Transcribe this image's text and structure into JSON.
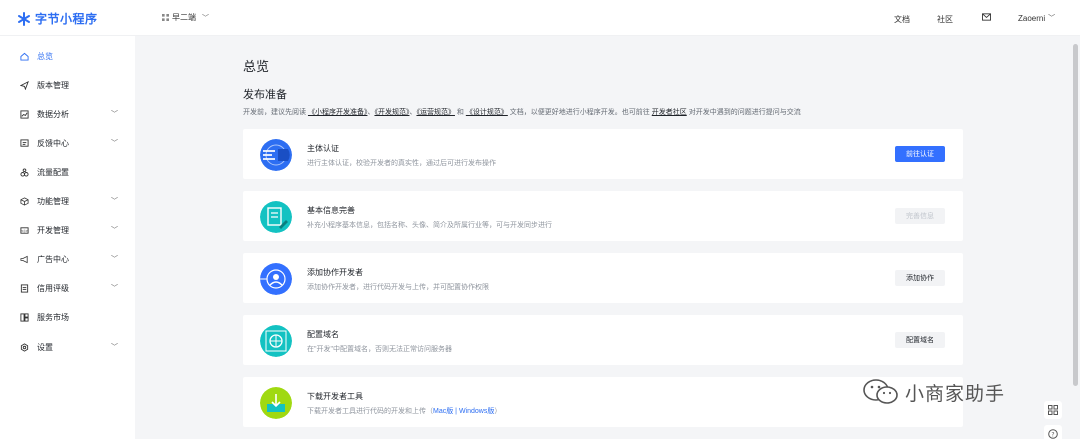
{
  "brand": {
    "name": "字节小程序",
    "color": "#2d6ef2"
  },
  "app_switch": {
    "label": "早二端"
  },
  "header": {
    "docs": "文档",
    "community": "社区",
    "user": "Zaoerni"
  },
  "sidebar": {
    "items": [
      {
        "label": "总览",
        "icon": "home-icon",
        "active": true,
        "expandable": false
      },
      {
        "label": "版本管理",
        "icon": "send-icon",
        "active": false,
        "expandable": false
      },
      {
        "label": "数据分析",
        "icon": "chart-icon",
        "active": false,
        "expandable": true
      },
      {
        "label": "反馈中心",
        "icon": "feedback-icon",
        "active": false,
        "expandable": true
      },
      {
        "label": "流量配置",
        "icon": "flow-icon",
        "active": false,
        "expandable": false
      },
      {
        "label": "功能管理",
        "icon": "cube-icon",
        "active": false,
        "expandable": true
      },
      {
        "label": "开发管理",
        "icon": "dev-icon",
        "active": false,
        "expandable": true
      },
      {
        "label": "广告中心",
        "icon": "megaphone-icon",
        "active": false,
        "expandable": true
      },
      {
        "label": "信用评级",
        "icon": "credit-icon",
        "active": false,
        "expandable": true
      },
      {
        "label": "服务市场",
        "icon": "market-icon",
        "active": false,
        "expandable": false
      },
      {
        "label": "设置",
        "icon": "gear-icon",
        "active": false,
        "expandable": true
      }
    ]
  },
  "main": {
    "page_title": "总览",
    "section_title": "发布准备",
    "intro": {
      "p1": "开发前，建议先阅读",
      "l1": "《小程序开发准备》",
      "s1": "、",
      "l2": "《开发规范》",
      "s2": "、",
      "l3": "《运营规范》",
      "s3": " 和 ",
      "l4": "《设计规范》",
      "p2": "文档，以便更好地进行小程序开发。也可前往",
      "l5": "开发者社区",
      "p3": "对开发中遇到的问题进行提问与交流"
    },
    "cards": [
      {
        "title": "主体认证",
        "desc": "进行主体认证，校验开发者的真实性，通过后可进行发布操作",
        "button": "前往认证",
        "button_style": "primary",
        "icon": "badge-icon",
        "color": "#2d6ef2"
      },
      {
        "title": "基本信息完善",
        "desc": "补充小程序基本信息，包括名称、头像、简介及所属行业等，可与开发同步进行",
        "button": "完善信息",
        "button_style": "disabled",
        "icon": "document-edit-icon",
        "color": "#13c2c2"
      },
      {
        "title": "添加协作开发者",
        "desc": "添加协作开发者，进行代码开发与上传，并可配置协作权限",
        "button": "添加协作",
        "button_style": "default",
        "icon": "user-add-icon",
        "color": "#3370ff"
      },
      {
        "title": "配置域名",
        "desc": "在\"开发\"中配置域名，否则无法正常访问服务器",
        "button": "配置域名",
        "button_style": "default",
        "icon": "globe-icon",
        "color": "#13c2c2"
      },
      {
        "title": "下载开发者工具",
        "desc": "下载开发者工具进行代码的开发和上传（",
        "link_mac": "Mac版",
        "link_sep": " | ",
        "link_win": "Windows版",
        "desc_end": "）",
        "icon": "download-icon",
        "color": "#8bc34a"
      }
    ]
  },
  "watermark": {
    "text": "小商家助手"
  }
}
